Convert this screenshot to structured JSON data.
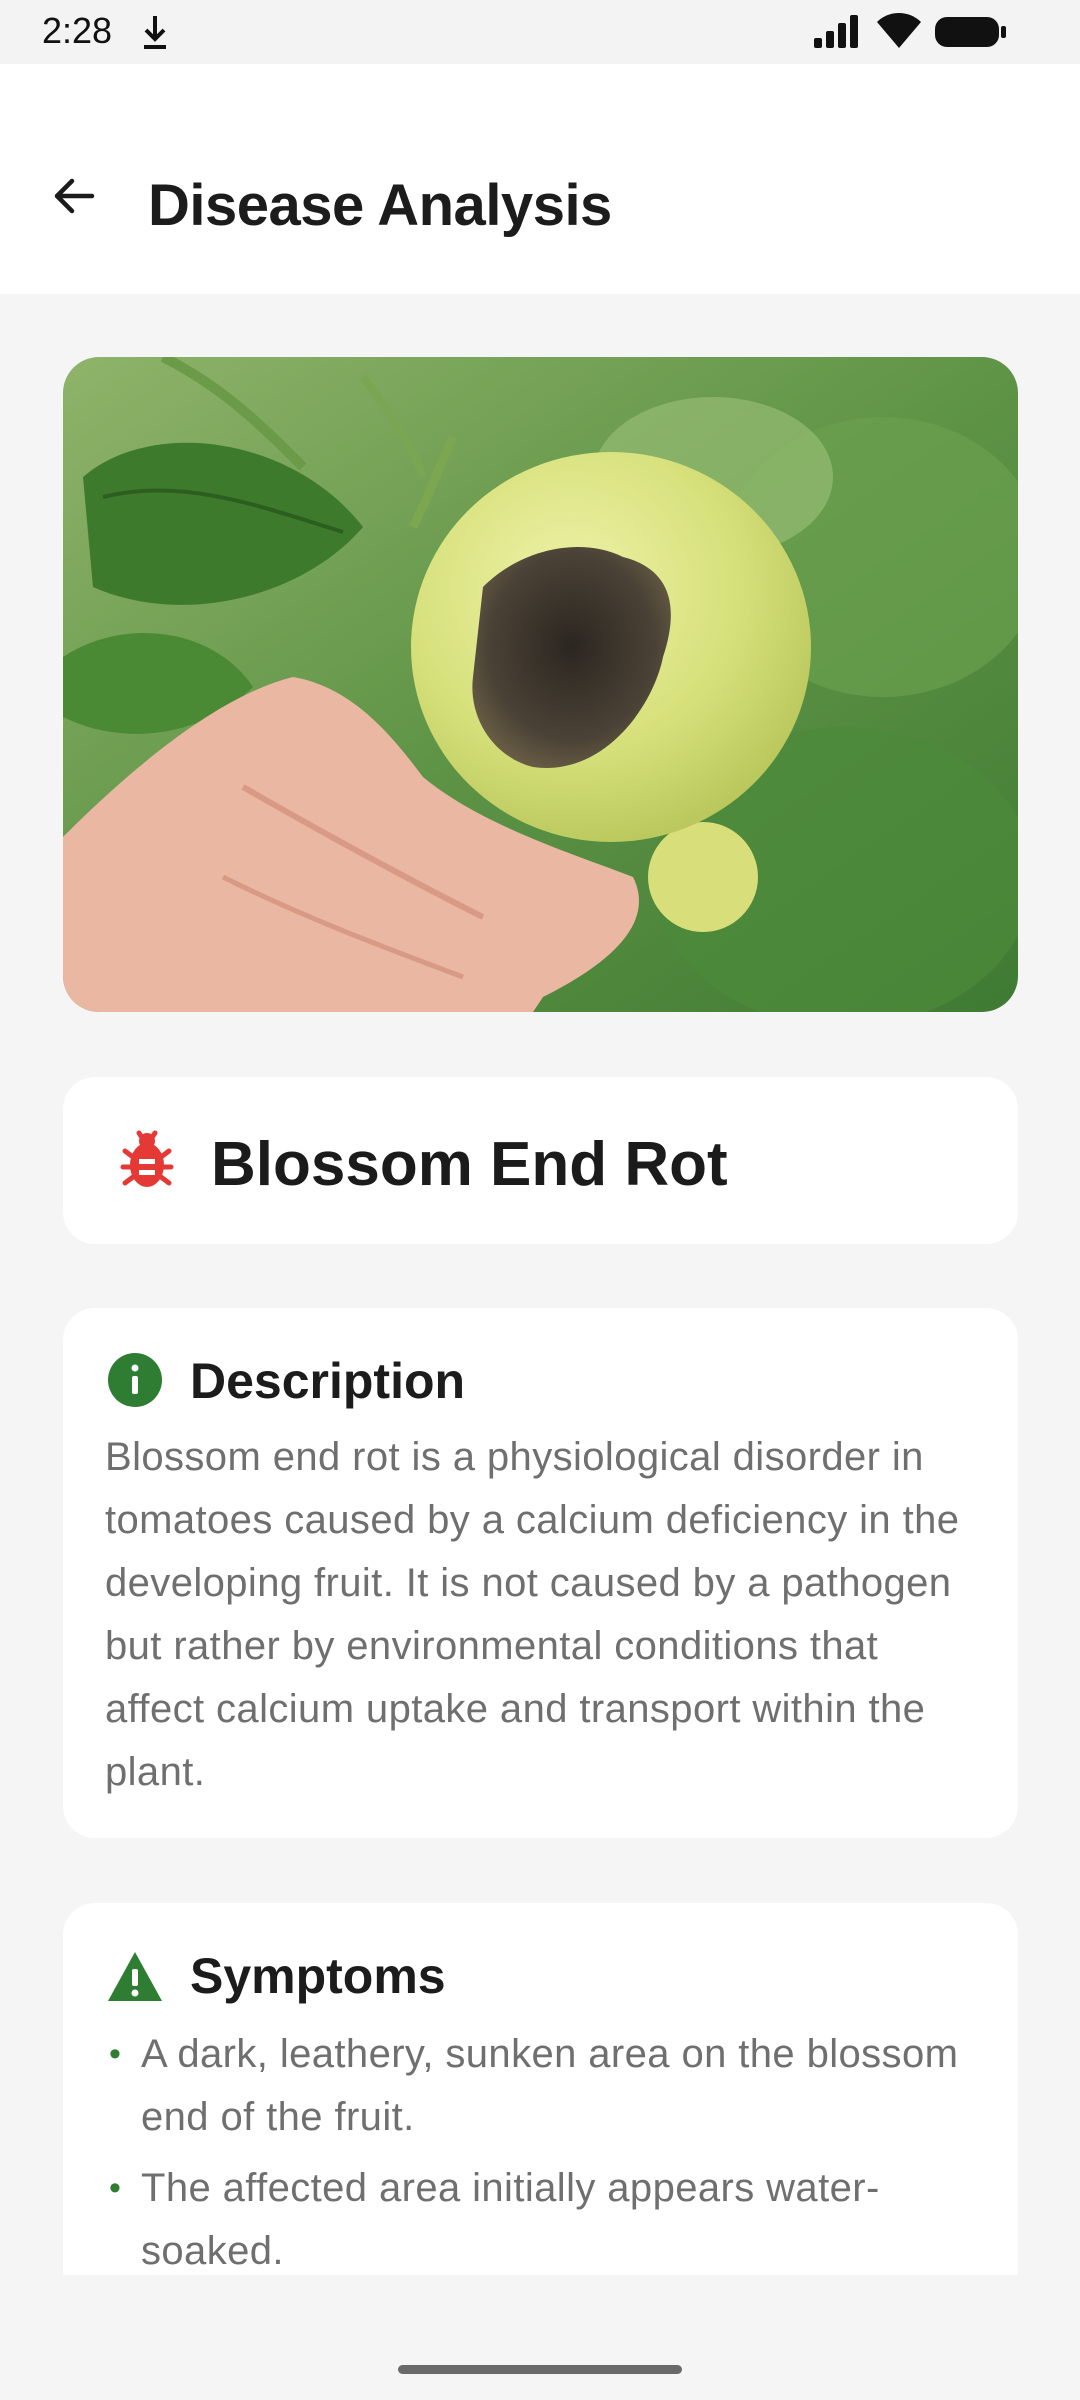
{
  "status_bar": {
    "time": "2:28"
  },
  "app_bar": {
    "title": "Disease Analysis",
    "back_icon": "arrow-back-icon"
  },
  "disease": {
    "name": "Blossom End Rot",
    "icon": "bug-icon",
    "icon_color": "#e53935"
  },
  "description": {
    "title": "Description",
    "icon": "info-icon",
    "text": "Blossom end rot is a physiological disorder in tomatoes caused by a calcium deficiency in the developing fruit. It is not caused by a pathogen but rather by environmental conditions that affect calcium uptake and transport within the plant."
  },
  "symptoms": {
    "title": "Symptoms",
    "icon": "warning-icon",
    "items": [
      "A dark, leathery, sunken area on the blossom end of the fruit.",
      "The affected area initially appears water-soaked."
    ]
  },
  "colors": {
    "accent_green": "#2e7d32",
    "bug_red": "#e53935",
    "background": "#f5f5f6",
    "card": "#ffffff"
  }
}
